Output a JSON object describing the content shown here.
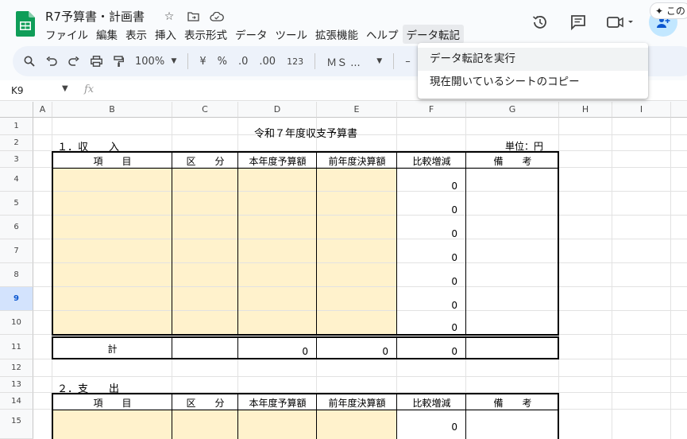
{
  "doc": {
    "title": "R7予算書・計画書"
  },
  "menu": [
    "ファイル",
    "編集",
    "表示",
    "挿入",
    "表示形式",
    "データ",
    "ツール",
    "拡張機能",
    "ヘルプ",
    "データ転記"
  ],
  "dropdown": [
    "データ転記を実行",
    "現在開いているシートのコピー"
  ],
  "toolbar": {
    "zoom": "100%",
    "currency": "¥",
    "percent": "%",
    "dec_minus": ".0",
    "dec_plus": ".00",
    "format_123": "123",
    "font": "ＭＳ ...",
    "font_minus": "–"
  },
  "formula_bar": {
    "cell_ref": "K9",
    "fx": "fx"
  },
  "gemini": {
    "label": "この"
  },
  "columns": [
    "A",
    "B",
    "C",
    "D",
    "E",
    "F",
    "G",
    "H",
    "I"
  ],
  "rows": [
    "1",
    "2",
    "3",
    "4",
    "5",
    "6",
    "7",
    "8",
    "9",
    "10",
    "11",
    "12",
    "13",
    "14",
    "15"
  ],
  "selected_row": "9",
  "sheet": {
    "title": "令和７年度収支予算書",
    "unit": "単位：円",
    "section1": "１．収　　入",
    "section2": "２．支　　出",
    "headers": [
      "項　　目",
      "区　　分",
      "本年度予算額",
      "前年度決算額",
      "比較増減",
      "備　　考"
    ],
    "income_diff": [
      "0",
      "0",
      "0",
      "0",
      "0",
      "0",
      "0"
    ],
    "total_label": "計",
    "total_current": "0",
    "total_prev": "0",
    "total_diff": "0",
    "expense_diff": [
      "0"
    ]
  }
}
